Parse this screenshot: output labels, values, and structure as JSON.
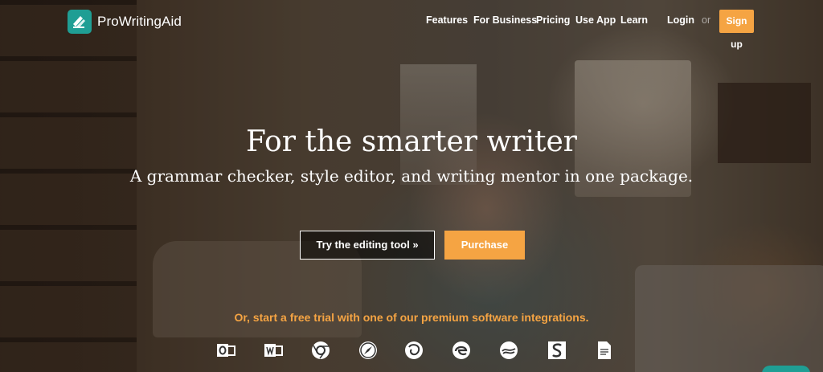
{
  "brand": {
    "name": "ProWritingAid",
    "logo_icon": "pen-stack-icon",
    "color": "#1f9e94"
  },
  "nav": {
    "items": [
      "Features",
      "For Business",
      "Pricing",
      "Use App",
      "Learn"
    ],
    "login": "Login",
    "or": "or",
    "signup": "Sign up"
  },
  "hero": {
    "headline": "For the smarter writer",
    "subheadline": "A grammar checker, style editor, and writing mentor in one package.",
    "try_button": "Try the editing tool »",
    "purchase_button": "Purchase",
    "trial_text": "Or, start a free trial with one of our premium software integrations."
  },
  "integrations": [
    "outlook-icon",
    "word-icon",
    "chrome-icon",
    "safari-icon",
    "firefox-icon",
    "edge-icon",
    "openoffice-icon",
    "scrivener-icon",
    "google-docs-icon"
  ],
  "colors": {
    "accent": "#f5a443",
    "text": "#ffffff",
    "brand": "#1f9e94"
  }
}
